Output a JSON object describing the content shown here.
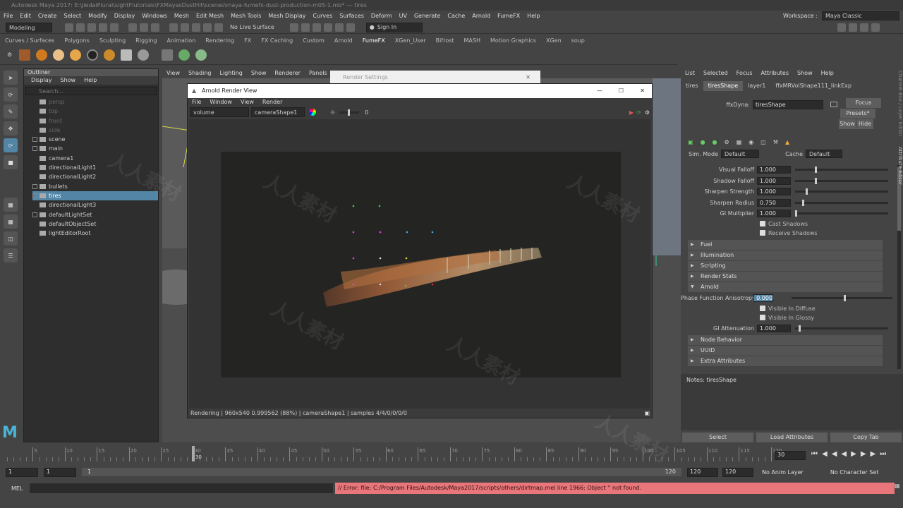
{
  "window": {
    "title": "Autodesk Maya 2017: E:\\JiedaiPlural\\sightFlutorials\\FXMayasDustHit\\scenes\\maya-fumefx-dust-production-m05-1.mb* --- tires"
  },
  "menubar": [
    "File",
    "Edit",
    "Create",
    "Select",
    "Modify",
    "Display",
    "Windows",
    "Mesh",
    "Edit Mesh",
    "Mesh Tools",
    "Mesh Display",
    "Curves",
    "Surfaces",
    "Deform",
    "UV",
    "Generate",
    "Cache",
    "Arnold",
    "FumeFX",
    "Help"
  ],
  "workspace": {
    "label": "Workspace :",
    "value": "Maya Classic"
  },
  "statusline": {
    "mode": "Modeling",
    "live_surface": "No Live Surface",
    "sign_in": "Sign In"
  },
  "shelf_tabs": [
    "Curves / Surfaces",
    "Polygons",
    "Sculpting",
    "Rigging",
    "Animation",
    "Rendering",
    "FX",
    "FX Caching",
    "Custom",
    "Arnold",
    "FumeFX",
    "XGen_User",
    "Bifrost",
    "MASH",
    "Motion Graphics",
    "XGen",
    "soup"
  ],
  "shelf_active": "FumeFX",
  "outliner": {
    "title": "Outliner",
    "menu": [
      "Display",
      "Show",
      "Help"
    ],
    "search_placeholder": "Search...",
    "items": [
      {
        "label": "persp",
        "dim": true,
        "exp": false
      },
      {
        "label": "top",
        "dim": true,
        "exp": false
      },
      {
        "label": "front",
        "dim": true,
        "exp": false
      },
      {
        "label": "side",
        "dim": true,
        "exp": false
      },
      {
        "label": "scene",
        "dim": false,
        "exp": true
      },
      {
        "label": "main",
        "dim": false,
        "exp": true
      },
      {
        "label": "camera1",
        "dim": false,
        "exp": false
      },
      {
        "label": "directionalLight1",
        "dim": false,
        "exp": false
      },
      {
        "label": "directionalLight2",
        "dim": false,
        "exp": false
      },
      {
        "label": "bullets",
        "dim": false,
        "exp": true
      },
      {
        "label": "tires",
        "dim": false,
        "exp": true,
        "sel": true
      },
      {
        "label": "directionalLight3",
        "dim": false,
        "exp": false
      },
      {
        "label": "defaultLightSet",
        "dim": false,
        "exp": true
      },
      {
        "label": "defaultObjectSet",
        "dim": false,
        "exp": false
      },
      {
        "label": "lightEditorRoot",
        "dim": false,
        "exp": false
      }
    ]
  },
  "viewport_menu": [
    "View",
    "Shading",
    "Lighting",
    "Show",
    "Renderer",
    "Panels"
  ],
  "render_settings": {
    "title": "Render Settings"
  },
  "render_view": {
    "title": "Arnold Render View",
    "menu": [
      "File",
      "Window",
      "View",
      "Render"
    ],
    "aov": "volume",
    "camera": "cameraShape1",
    "exposure": "0",
    "status": "Rendering | 960x540 0.999562 (88%) | cameraShape1 | samples 4/4/0/0/0/0"
  },
  "attr_editor": {
    "menu": [
      "List",
      "Selected",
      "Focus",
      "Attributes",
      "Show",
      "Help"
    ],
    "tabs": [
      "tires",
      "tiresShape",
      "layer1",
      "ffxMRVolShape111_linkExp"
    ],
    "active_tab": "tiresShape",
    "node_label": "ffxDyna:",
    "node_value": "tiresShape",
    "buttons": {
      "focus": "Focus",
      "presets": "Presets*",
      "show": "Show",
      "hide": "Hide"
    },
    "sim_mode_label": "Sim. Mode",
    "sim_mode": "Default",
    "cache_label": "Cache",
    "cache": "Default",
    "attrs": [
      {
        "label": "Visual Falloff",
        "value": "1.000",
        "level": 0.22
      },
      {
        "label": "Shadow Falloff",
        "value": "1.000",
        "level": 0.22
      },
      {
        "label": "Sharpen Strength",
        "value": "1.000",
        "level": 0.12
      },
      {
        "label": "Sharpen Radius",
        "value": "0.750",
        "level": 0.08
      },
      {
        "label": "GI Multiplier",
        "value": "1.000",
        "level": 0.0
      }
    ],
    "checks1": [
      "Cast Shadows",
      "Receive Shadows"
    ],
    "sections1": [
      "Fuel",
      "Illumination",
      "Scripting",
      "Render Stats"
    ],
    "arnold_section": "Arnold",
    "phase_label": "Phase Function Anisotropy",
    "phase_value": "0.000",
    "phase_level": 0.5,
    "checks2": [
      "Visible In Diffuse",
      "Visible In Glossy"
    ],
    "gi_att_label": "GI Attenuation",
    "gi_att_value": "1.000",
    "gi_att_level": 0.04,
    "sections2": [
      "Node Behavior",
      "UUID",
      "Extra Attributes"
    ],
    "notes": "Notes: tiresShape",
    "bottom_buttons": [
      "Select",
      "Load Attributes",
      "Copy Tab"
    ]
  },
  "timeline": {
    "ticks": [
      "5",
      "10",
      "15",
      "20",
      "25",
      "30",
      "35",
      "40",
      "45",
      "50",
      "55",
      "60",
      "65",
      "70",
      "75",
      "80",
      "85",
      "90",
      "95",
      "100",
      "105",
      "110",
      "115",
      "120"
    ],
    "current": "30",
    "current_frame": "30"
  },
  "range": {
    "start": "1",
    "start2": "1",
    "mid": "1",
    "end_inner": "120",
    "end": "120",
    "end2": "120",
    "anim_layer": "No Anim Layer",
    "char_set": "No Character Set"
  },
  "cmd": {
    "label": "MEL",
    "error": "// Error: file: C:/Program Files/Autodesk/Maya2017/scripts/others/dirtmap.mel line 1966: Object '' not found."
  }
}
